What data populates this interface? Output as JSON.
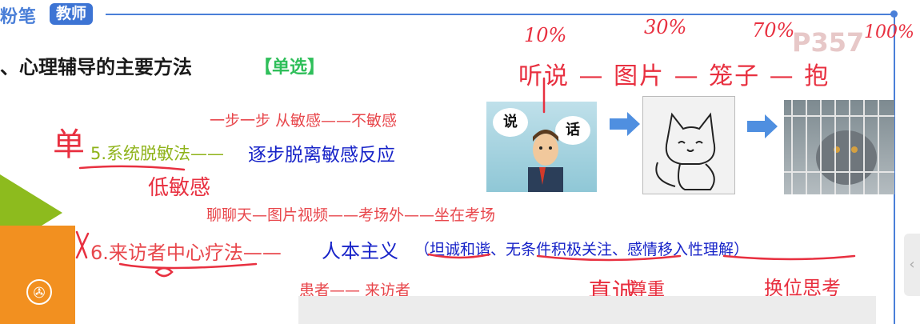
{
  "header": {
    "brand": "粉笔",
    "badge": "教师",
    "page_number": "P357"
  },
  "title": {
    "text": "、心理辅导的主要方法",
    "tag": "【单选】"
  },
  "item5": {
    "note": "一步一步   从敏感——不敏感",
    "label": "5.系统脱敏法——",
    "desc": "逐步脱离敏感反应"
  },
  "item6": {
    "note": "聊聊天—图片视频——考场外——坐在考场",
    "label": "6.来访者中心疗法——",
    "desc": "人本主义",
    "detail": "（坦诚和谐、无条件积极关注、感情移入性理解）",
    "note2": "患者——  来访者"
  },
  "images": {
    "talk_left": "说",
    "talk_right": "话"
  },
  "handwriting": {
    "p10": "10%",
    "p30": "30%",
    "p70": "70%",
    "p100": "100%",
    "steps": "听说 — 图片 — 笼子 — 抱",
    "left_mark": "单",
    "left_under": "低敏感",
    "under1": "真诚",
    "under2": "尊重",
    "under3": "换位思考"
  },
  "colors": {
    "brand": "#4a7fd8",
    "accent_red": "#e8474c",
    "accent_blue": "#1723c8",
    "accent_green": "#2fbf5a"
  }
}
